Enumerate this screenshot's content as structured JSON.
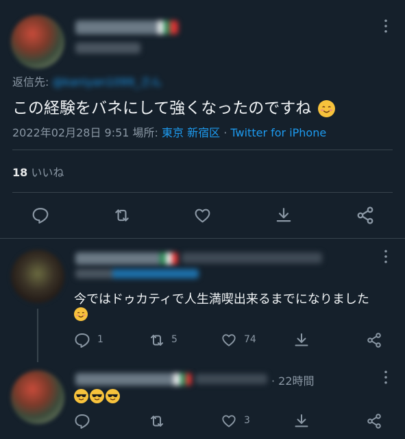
{
  "main_tweet": {
    "reply_to_label": "返信先:",
    "reply_to_handle": "@kaniyan1099_さん",
    "text": "この経験をバネにして強くなったのですね",
    "emoji": "smiling-face-emoji",
    "date": "2022年02月28日 9:51 場所: ",
    "location": "東京 新宿区",
    "separator": " · ",
    "source": "Twitter for iPhone",
    "likes_count": "18",
    "likes_label": "いいね"
  },
  "replies": [
    {
      "text": "今ではドゥカティで人生満喫出来るまでになりました",
      "reply_count": "1",
      "retweet_count": "5",
      "like_count": "74"
    },
    {
      "time": "· 22時間",
      "reply_count": "",
      "retweet_count": "",
      "like_count": "3"
    }
  ],
  "icons": [
    "more-icon",
    "reply-icon",
    "retweet-icon",
    "like-icon",
    "share-icon",
    "share-network-icon"
  ],
  "colors": {
    "background": "#15202b",
    "accent": "#1d9bf0",
    "muted": "#8b98a5",
    "divider": "#38444d"
  }
}
